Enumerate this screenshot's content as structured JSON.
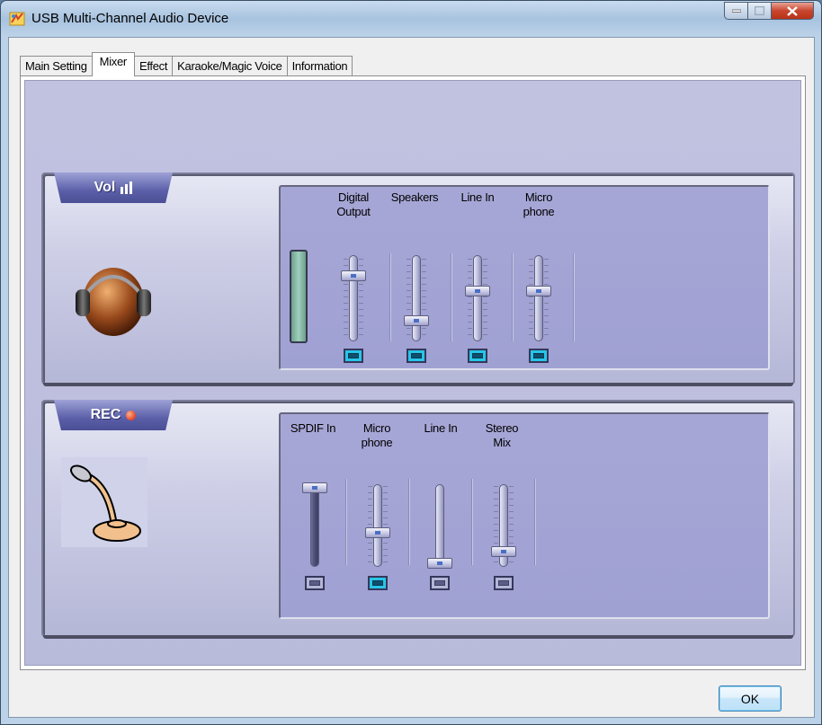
{
  "window": {
    "title": "USB Multi-Channel Audio Device"
  },
  "tabs": [
    {
      "label": "Main Setting"
    },
    {
      "label": "Mixer",
      "active": true
    },
    {
      "label": "Effect"
    },
    {
      "label": "Karaoke/Magic Voice"
    },
    {
      "label": "Information"
    }
  ],
  "playback": {
    "badge": "Vol",
    "channels": [
      {
        "label_line1": "Digital",
        "label_line2": "Output",
        "level": 0.8,
        "mute_enabled": true
      },
      {
        "label_line1": "Speakers",
        "label_line2": "",
        "level": 0.2,
        "mute_enabled": true
      },
      {
        "label_line1": "Line In",
        "label_line2": "",
        "level": 0.6,
        "mute_enabled": true
      },
      {
        "label_line1": "Micro",
        "label_line2": "phone",
        "level": 0.6,
        "mute_enabled": true
      }
    ]
  },
  "record": {
    "badge": "REC",
    "channels": [
      {
        "label_line1": "SPDIF In",
        "label_line2": "",
        "level": 1.0,
        "mute_enabled": false
      },
      {
        "label_line1": "Micro",
        "label_line2": "phone",
        "level": 0.4,
        "mute_enabled": true
      },
      {
        "label_line1": "Line In",
        "label_line2": "",
        "level": 0.0,
        "mute_enabled": false
      },
      {
        "label_line1": "Stereo",
        "label_line2": "Mix",
        "level": 0.15,
        "mute_enabled": false
      }
    ]
  },
  "buttons": {
    "ok": "OK"
  }
}
